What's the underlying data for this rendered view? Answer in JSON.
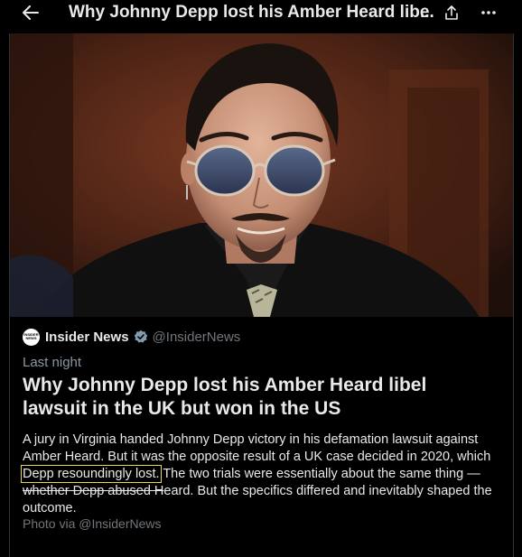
{
  "header": {
    "title": "Why Johnny Depp lost his Amber Heard libel",
    "ellipsis": "..."
  },
  "card": {
    "publisher_name": "Insider News",
    "publisher_logo_text": "INSIDER NEWS",
    "handle": "@InsiderNews",
    "timestamp": "Last night",
    "headline": "Why Johnny Depp lost his Amber Heard libel lawsuit in the UK but won in the US",
    "body": {
      "part1": "A jury in Virginia handed Johnny Depp victory in his defamation lawsuit against Amber Heard. But it was the opposite result of a UK case decided in 2020, which ",
      "highlighted": "Depp resoundingly lost.",
      "part2": " The two trials were essentially about the same thing — ",
      "struck": "whether Depp abused H",
      "part3": "eard. But the specifics differed and inevitably shaped the outcome."
    },
    "photo_credit": "Photo via @InsiderNews"
  },
  "colors": {
    "background": "#000000",
    "text": "#e7e9ea",
    "muted": "#71767b",
    "verified": "#829aab",
    "highlight_box": "#e8d94a"
  }
}
